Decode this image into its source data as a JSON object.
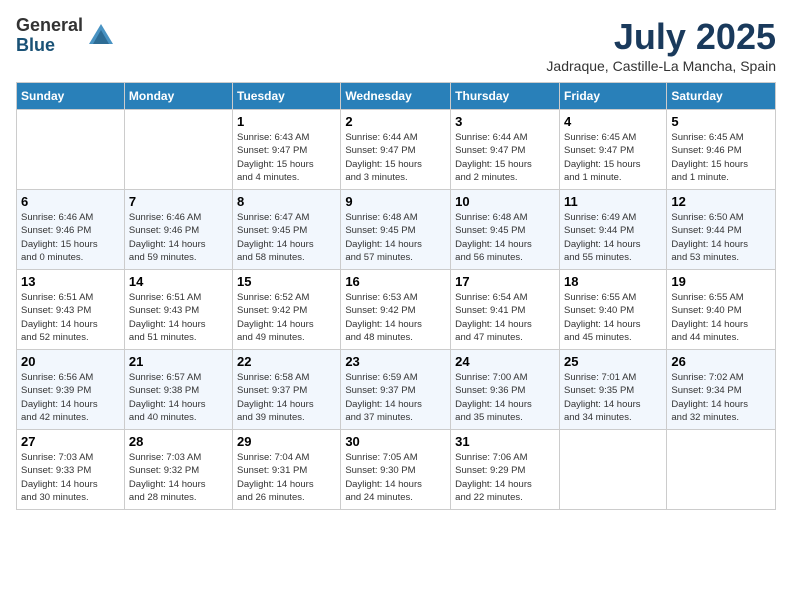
{
  "header": {
    "logo_general": "General",
    "logo_blue": "Blue",
    "month": "July 2025",
    "location": "Jadraque, Castille-La Mancha, Spain"
  },
  "weekdays": [
    "Sunday",
    "Monday",
    "Tuesday",
    "Wednesday",
    "Thursday",
    "Friday",
    "Saturday"
  ],
  "weeks": [
    [
      {
        "day": "",
        "info": ""
      },
      {
        "day": "",
        "info": ""
      },
      {
        "day": "1",
        "info": "Sunrise: 6:43 AM\nSunset: 9:47 PM\nDaylight: 15 hours\nand 4 minutes."
      },
      {
        "day": "2",
        "info": "Sunrise: 6:44 AM\nSunset: 9:47 PM\nDaylight: 15 hours\nand 3 minutes."
      },
      {
        "day": "3",
        "info": "Sunrise: 6:44 AM\nSunset: 9:47 PM\nDaylight: 15 hours\nand 2 minutes."
      },
      {
        "day": "4",
        "info": "Sunrise: 6:45 AM\nSunset: 9:47 PM\nDaylight: 15 hours\nand 1 minute."
      },
      {
        "day": "5",
        "info": "Sunrise: 6:45 AM\nSunset: 9:46 PM\nDaylight: 15 hours\nand 1 minute."
      }
    ],
    [
      {
        "day": "6",
        "info": "Sunrise: 6:46 AM\nSunset: 9:46 PM\nDaylight: 15 hours\nand 0 minutes."
      },
      {
        "day": "7",
        "info": "Sunrise: 6:46 AM\nSunset: 9:46 PM\nDaylight: 14 hours\nand 59 minutes."
      },
      {
        "day": "8",
        "info": "Sunrise: 6:47 AM\nSunset: 9:45 PM\nDaylight: 14 hours\nand 58 minutes."
      },
      {
        "day": "9",
        "info": "Sunrise: 6:48 AM\nSunset: 9:45 PM\nDaylight: 14 hours\nand 57 minutes."
      },
      {
        "day": "10",
        "info": "Sunrise: 6:48 AM\nSunset: 9:45 PM\nDaylight: 14 hours\nand 56 minutes."
      },
      {
        "day": "11",
        "info": "Sunrise: 6:49 AM\nSunset: 9:44 PM\nDaylight: 14 hours\nand 55 minutes."
      },
      {
        "day": "12",
        "info": "Sunrise: 6:50 AM\nSunset: 9:44 PM\nDaylight: 14 hours\nand 53 minutes."
      }
    ],
    [
      {
        "day": "13",
        "info": "Sunrise: 6:51 AM\nSunset: 9:43 PM\nDaylight: 14 hours\nand 52 minutes."
      },
      {
        "day": "14",
        "info": "Sunrise: 6:51 AM\nSunset: 9:43 PM\nDaylight: 14 hours\nand 51 minutes."
      },
      {
        "day": "15",
        "info": "Sunrise: 6:52 AM\nSunset: 9:42 PM\nDaylight: 14 hours\nand 49 minutes."
      },
      {
        "day": "16",
        "info": "Sunrise: 6:53 AM\nSunset: 9:42 PM\nDaylight: 14 hours\nand 48 minutes."
      },
      {
        "day": "17",
        "info": "Sunrise: 6:54 AM\nSunset: 9:41 PM\nDaylight: 14 hours\nand 47 minutes."
      },
      {
        "day": "18",
        "info": "Sunrise: 6:55 AM\nSunset: 9:40 PM\nDaylight: 14 hours\nand 45 minutes."
      },
      {
        "day": "19",
        "info": "Sunrise: 6:55 AM\nSunset: 9:40 PM\nDaylight: 14 hours\nand 44 minutes."
      }
    ],
    [
      {
        "day": "20",
        "info": "Sunrise: 6:56 AM\nSunset: 9:39 PM\nDaylight: 14 hours\nand 42 minutes."
      },
      {
        "day": "21",
        "info": "Sunrise: 6:57 AM\nSunset: 9:38 PM\nDaylight: 14 hours\nand 40 minutes."
      },
      {
        "day": "22",
        "info": "Sunrise: 6:58 AM\nSunset: 9:37 PM\nDaylight: 14 hours\nand 39 minutes."
      },
      {
        "day": "23",
        "info": "Sunrise: 6:59 AM\nSunset: 9:37 PM\nDaylight: 14 hours\nand 37 minutes."
      },
      {
        "day": "24",
        "info": "Sunrise: 7:00 AM\nSunset: 9:36 PM\nDaylight: 14 hours\nand 35 minutes."
      },
      {
        "day": "25",
        "info": "Sunrise: 7:01 AM\nSunset: 9:35 PM\nDaylight: 14 hours\nand 34 minutes."
      },
      {
        "day": "26",
        "info": "Sunrise: 7:02 AM\nSunset: 9:34 PM\nDaylight: 14 hours\nand 32 minutes."
      }
    ],
    [
      {
        "day": "27",
        "info": "Sunrise: 7:03 AM\nSunset: 9:33 PM\nDaylight: 14 hours\nand 30 minutes."
      },
      {
        "day": "28",
        "info": "Sunrise: 7:03 AM\nSunset: 9:32 PM\nDaylight: 14 hours\nand 28 minutes."
      },
      {
        "day": "29",
        "info": "Sunrise: 7:04 AM\nSunset: 9:31 PM\nDaylight: 14 hours\nand 26 minutes."
      },
      {
        "day": "30",
        "info": "Sunrise: 7:05 AM\nSunset: 9:30 PM\nDaylight: 14 hours\nand 24 minutes."
      },
      {
        "day": "31",
        "info": "Sunrise: 7:06 AM\nSunset: 9:29 PM\nDaylight: 14 hours\nand 22 minutes."
      },
      {
        "day": "",
        "info": ""
      },
      {
        "day": "",
        "info": ""
      }
    ]
  ]
}
